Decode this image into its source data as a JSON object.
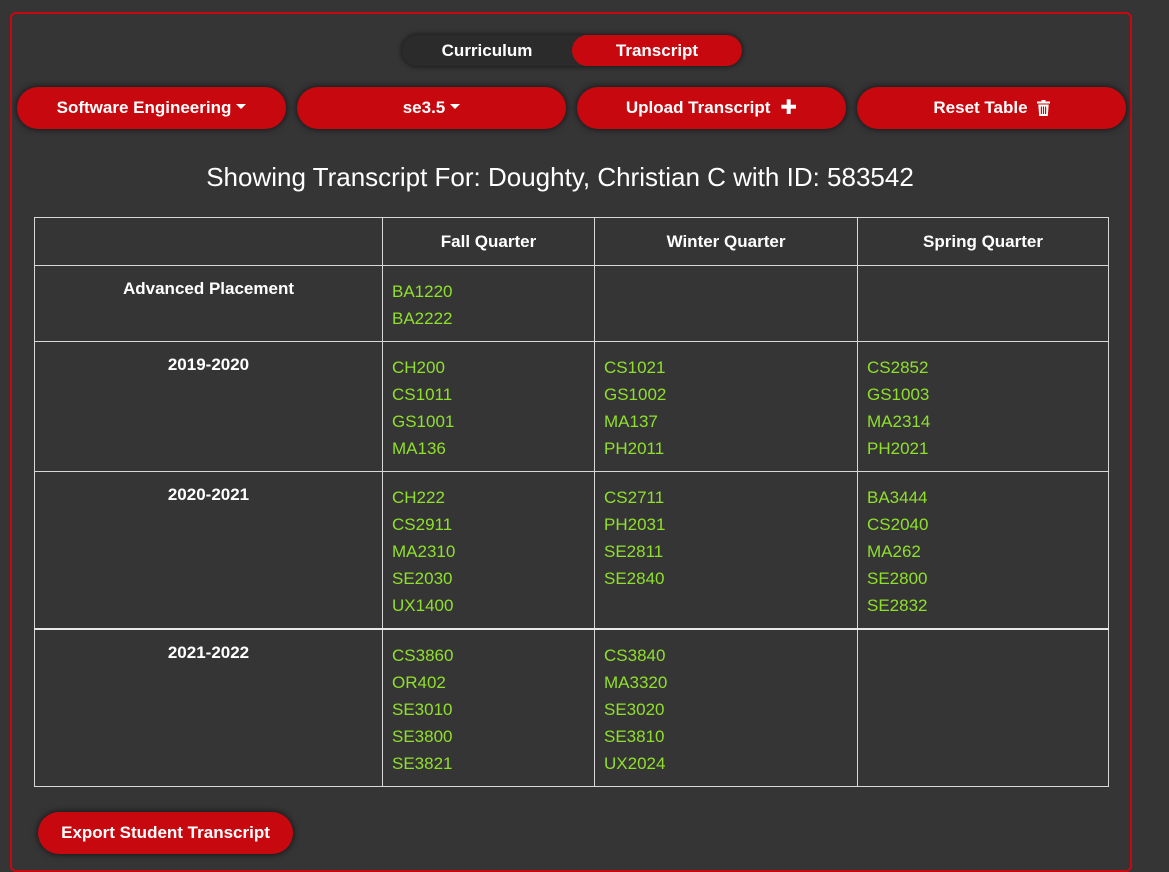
{
  "tabs": [
    "Curriculum",
    "Transcript"
  ],
  "active_tab": "Transcript",
  "toolbar": {
    "major": "Software Engineering",
    "version": "se3.5",
    "upload": "Upload Transcript",
    "reset": "Reset Table"
  },
  "heading": "Showing Transcript For: Doughty, Christian C with ID: 583542",
  "table": {
    "headers": [
      "",
      "Fall Quarter",
      "Winter Quarter",
      "Spring Quarter"
    ],
    "rows": [
      {
        "label": "Advanced Placement",
        "fall": [
          "BA1220",
          "BA2222"
        ],
        "winter": [],
        "spring": []
      },
      {
        "label": "2019-2020",
        "fall": [
          "CH200",
          "CS1011",
          "GS1001",
          "MA136"
        ],
        "winter": [
          "CS1021",
          "GS1002",
          "MA137",
          "PH2011"
        ],
        "spring": [
          "CS2852",
          "GS1003",
          "MA2314",
          "PH2021"
        ]
      },
      {
        "label": "2020-2021",
        "fall": [
          "CH222",
          "CS2911",
          "MA2310",
          "SE2030",
          "UX1400"
        ],
        "winter": [
          "CS2711",
          "PH2031",
          "SE2811",
          "SE2840"
        ],
        "spring": [
          "BA3444",
          "CS2040",
          "MA262",
          "SE2800",
          "SE2832"
        ]
      },
      {
        "label": "2021-2022",
        "fall": [
          "CS3860",
          "OR402",
          "SE3010",
          "SE3800",
          "SE3821"
        ],
        "winter": [
          "CS3840",
          "MA3320",
          "SE3020",
          "SE3810",
          "UX2024"
        ],
        "spring": []
      }
    ]
  },
  "export": "Export Student Transcript",
  "colors": {
    "accent": "#c8080f",
    "background": "#353535",
    "course_text": "#8fe02a"
  }
}
